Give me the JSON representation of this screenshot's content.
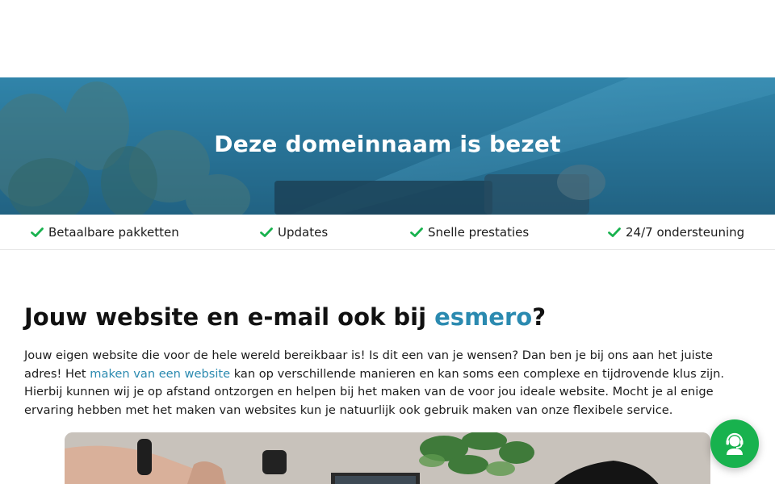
{
  "hero": {
    "title": "Deze domeinnaam is bezet"
  },
  "usps": [
    {
      "label": "Betaalbare pakketten",
      "icon": "check-icon"
    },
    {
      "label": "Updates",
      "icon": "check-icon"
    },
    {
      "label": "Snelle prestaties",
      "icon": "check-icon"
    },
    {
      "label": "24/7 ondersteuning",
      "icon": "check-icon"
    }
  ],
  "main": {
    "heading_prefix": "Jouw website en e-mail ook bij ",
    "heading_brand": "esmero",
    "heading_suffix": "?",
    "intro_part1": "Jouw eigen website die voor de hele wereld bereikbaar is! Is dit een van je wensen? Dan ben je bij ons aan het juiste adres! Het ",
    "intro_link": "maken van een website",
    "intro_part2": " kan op verschillende manieren en kan soms een complexe en tijdrovende klus zijn. Hierbij kunnen wij je op afstand ontzorgen en helpen bij het maken van de voor jou ideale website. Mocht je al enige ervaring hebben met het maken van websites kun je natuurlijk ook gebruik maken van onze flexibele service."
  },
  "chat": {
    "icon": "support-agent-icon"
  },
  "colors": {
    "accent": "#2b8ab0",
    "check": "#18b24e",
    "hero": "#2a6f90"
  }
}
